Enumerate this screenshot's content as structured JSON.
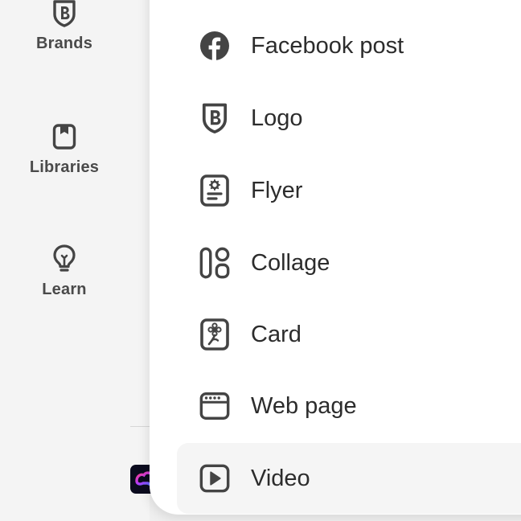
{
  "rail": {
    "items": [
      {
        "label": "Brands",
        "icon": "brand-shield-icon"
      },
      {
        "label": "Libraries",
        "icon": "library-icon"
      },
      {
        "label": "Learn",
        "icon": "lightbulb-icon"
      }
    ]
  },
  "menu": {
    "items": [
      {
        "label": "Facebook post",
        "icon": "facebook-icon"
      },
      {
        "label": "Logo",
        "icon": "logo-shield-icon"
      },
      {
        "label": "Flyer",
        "icon": "flyer-icon"
      },
      {
        "label": "Collage",
        "icon": "collage-icon"
      },
      {
        "label": "Card",
        "icon": "card-icon"
      },
      {
        "label": "Web page",
        "icon": "web-page-icon"
      },
      {
        "label": "Video",
        "icon": "video-icon"
      }
    ]
  },
  "colors": {
    "icon": "#444444",
    "text": "#2c2c2c",
    "panel": "#ffffff",
    "rail": "#f4f4f4",
    "highlight": "#f5f5f5"
  }
}
